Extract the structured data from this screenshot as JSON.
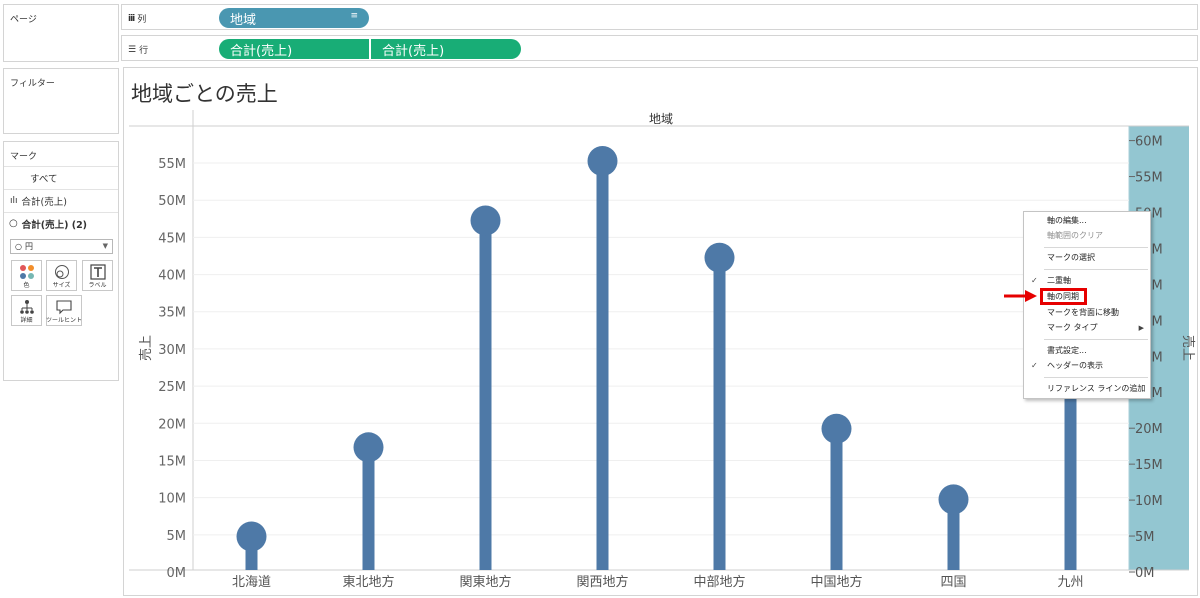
{
  "panels": {
    "pages_title": "ページ",
    "filters_title": "フィルター",
    "marks_title": "マーク",
    "marks_all": "すべて",
    "marks_bar_label": "合計(売上)",
    "marks_circle_label": "合計(売上) (2)",
    "mark_type_value": "円",
    "mark_buttons": {
      "color": "色",
      "size": "サイズ",
      "label": "ラベル",
      "detail": "詳細",
      "tooltip": "ツールヒント"
    }
  },
  "shelves": {
    "columns_label": "列",
    "rows_label": "行",
    "columns_pill": "地域",
    "rows_pills": [
      "合計(売上)",
      "合計(売上)"
    ]
  },
  "sheet": {
    "title": "地域ごとの売上"
  },
  "chart_data": {
    "type": "lollipop",
    "title": "地域ごとの売上",
    "header": "地域",
    "categories": [
      "北海道",
      "東北地方",
      "関東地方",
      "関西地方",
      "中部地方",
      "中国地方",
      "四国",
      "九州"
    ],
    "values": [
      4.5,
      16.5,
      47,
      55,
      42,
      19,
      9.5,
      46
    ],
    "ylabel": "売上",
    "y2label": "売上",
    "ylim": [
      0,
      58.5
    ],
    "y2lim": [
      0,
      60.5
    ],
    "yticks": [
      "0M",
      "5M",
      "10M",
      "15M",
      "20M",
      "25M",
      "30M",
      "35M",
      "40M",
      "45M",
      "50M",
      "55M"
    ],
    "y2ticks": [
      "0M",
      "5M",
      "10M",
      "15M",
      "20M",
      "25M",
      "30M",
      "35M",
      "40M",
      "45M",
      "50M",
      "55M",
      "60M"
    ],
    "color": "#4e79a7",
    "axis_highlight": "#93c6d1"
  },
  "context_menu": {
    "items": [
      {
        "label": "軸の編集...",
        "disabled": false,
        "checked": false
      },
      {
        "label": "軸範囲のクリア",
        "disabled": true,
        "checked": false
      },
      {
        "label": "マークの選択",
        "disabled": false,
        "checked": false
      },
      {
        "label": "二重軸",
        "disabled": false,
        "checked": true
      },
      {
        "label": "軸の同期",
        "disabled": false,
        "checked": false
      },
      {
        "label": "マークを背面に移動",
        "disabled": false,
        "checked": false
      },
      {
        "label": "マーク タイプ",
        "disabled": false,
        "checked": false
      },
      {
        "label": "書式設定...",
        "disabled": false,
        "checked": false
      },
      {
        "label": "ヘッダーの表示",
        "disabled": false,
        "checked": true
      },
      {
        "label": "リファレンス ラインの追加",
        "disabled": false,
        "checked": false
      }
    ],
    "highlighted_item": "軸の同期"
  },
  "colors": {
    "pill_blue": "#4a97b1",
    "pill_green": "#18ad76",
    "highlight_red": "#e60000"
  }
}
